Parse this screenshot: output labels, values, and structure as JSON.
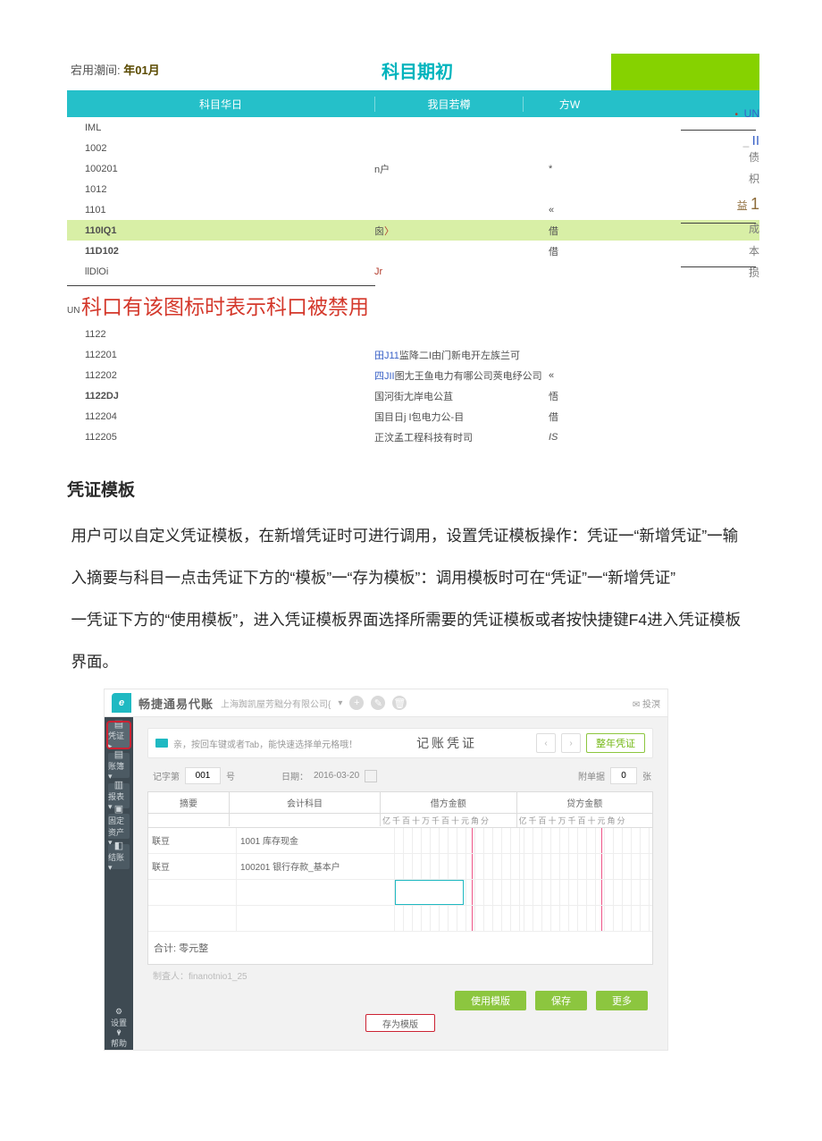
{
  "top_period_label": "宕用潮间:",
  "top_period_value": "年01月",
  "page_title": "科目期初",
  "table_headers": {
    "code": "科目华日",
    "name": "我目若樽",
    "dir": "方W"
  },
  "rows": [
    {
      "code": "IML",
      "name": "",
      "dir": ""
    },
    {
      "code": "1002",
      "name": "",
      "dir": ""
    },
    {
      "code": "100201",
      "name": "n户",
      "dir": "*"
    },
    {
      "code": "1012",
      "name": "",
      "dir": ""
    },
    {
      "code": "1101",
      "name": "",
      "dir": "«"
    },
    {
      "code": "110IQ1",
      "name": "囪",
      "name_suffix": "〉",
      "dir": "借",
      "hl": true,
      "bold": true
    },
    {
      "code": "11D102",
      "name": "",
      "dir": "借",
      "bold": true
    },
    {
      "code": "llDlOi",
      "name": "Jr",
      "dir": "",
      "red": true
    },
    {
      "callout": true
    },
    {
      "code": "1122",
      "name": "",
      "dir": ""
    },
    {
      "code": "112201",
      "name_pref": "田J11",
      "name": "监降二I由门新电开左族兰可",
      "dir": "",
      "blue": true
    },
    {
      "code": "112202",
      "name_pref": "四JII",
      "name": "图尢王鱼电力有哪公司莢电纾公司",
      "dir": "«"
    },
    {
      "code": "1122DJ",
      "name": "国河街尢岸电公苴",
      "dir": "悟",
      "bold": true
    },
    {
      "code": "112204",
      "name": "国目日j  I包电力公-目",
      "dir": "借"
    },
    {
      "code": "112205",
      "name": "正汶孟工程科技有时司",
      "dir": "IS",
      "ital": true
    }
  ],
  "callout_un_sub": "UN",
  "callout_text": "科口有该图标时表示科口被禁用",
  "side_labels": [
    "UN",
    "II",
    "债",
    "枳",
    "益",
    "1",
    "成",
    "本",
    "损"
  ],
  "doc": {
    "heading": "凭证模板",
    "p1": "用户可以自定义凭证模板，在新增凭证时可进行调用，设置凭证模板操作：凭证一“新增凭证”一输",
    "p2": "入摘要与科目一点击凭证下方的“模板”一“存为模板”：调用模板时可在“凭证”一“新增凭证”",
    "p3": "一凭证下方的“使用模板”，进入凭证模板界面选择所需要的凭证模板或者按快捷键F4进入凭证模板",
    "p4": "界面。"
  },
  "app": {
    "brand": "畅捷通易代账",
    "sub_company": "上海踟凯屋芳黜分有限公司{",
    "caret": "▾",
    "top_reply": "✉ 投溟",
    "side_items": [
      "凭证 ▸",
      "账簿 ▾",
      "报表 ▾",
      "固定资产 ▾",
      "结账 ▾"
    ],
    "side_small": [
      "设置 ▾",
      "帮助"
    ],
    "tip_text": "亲，按回车键或者Tab，能快速选择单元格哦！",
    "center_title": "记账凭证",
    "new_btn": "整年凭证",
    "meta": {
      "num_label": "记字第",
      "num_value": "001",
      "num_suffix": "号",
      "date_label": "日期：",
      "date_value": "2016-03-20",
      "att_label": "附单据",
      "att_value": "0",
      "att_suffix": "张"
    },
    "vt_headers": {
      "summary": "摘要",
      "account": "会计科目",
      "debit": "借方金额",
      "credit": "贷方金额"
    },
    "vt_digits": "亿千百十万千百十元角分",
    "vt_rows": [
      {
        "summary": "联豆",
        "account": "1001 库存现金"
      },
      {
        "summary": "联豆",
        "account": "100201 银行存款_基本户"
      },
      {
        "summary": "",
        "account": "",
        "selbox": true
      },
      {
        "summary": "",
        "account": ""
      }
    ],
    "total_label": "合计: 零元整",
    "maker_label": "制査人：finanotnio1_25",
    "btn_use": "使用模版",
    "btn_save": "保存",
    "btn_save_tpl": "存为模版",
    "btn_more": "更多"
  }
}
